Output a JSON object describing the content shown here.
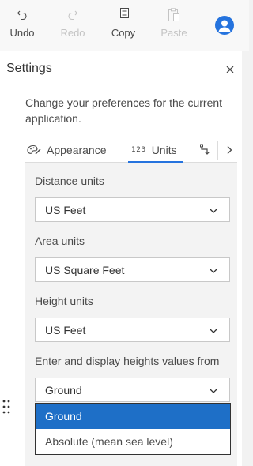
{
  "toolbar": {
    "undo": {
      "label": "Undo",
      "icon": "undo-icon",
      "enabled": true
    },
    "redo": {
      "label": "Redo",
      "icon": "redo-icon",
      "enabled": false
    },
    "copy": {
      "label": "Copy",
      "icon": "copy-icon",
      "enabled": true
    },
    "paste": {
      "label": "Paste",
      "icon": "paste-icon",
      "enabled": false
    },
    "user": {
      "icon": "user-avatar-icon"
    }
  },
  "panel": {
    "title": "Settings",
    "description": "Change your preferences for the current application.",
    "tabs": [
      {
        "label": "Appearance",
        "icon": "palette-icon",
        "active": false
      },
      {
        "label": "Units",
        "icon": "numbers-123-icon",
        "active": true
      },
      {
        "label": "",
        "icon": "snapping-icon",
        "active": false
      }
    ]
  },
  "units": {
    "distance": {
      "label": "Distance units",
      "value": "US Feet"
    },
    "area": {
      "label": "Area units",
      "value": "US Square Feet"
    },
    "height": {
      "label": "Height units",
      "value": "US Feet"
    },
    "height_reference": {
      "label": "Enter and display heights values from",
      "value": "Ground",
      "options": [
        "Ground",
        "Absolute (mean sea level)"
      ]
    }
  },
  "colors": {
    "accent": "#2573de",
    "selected": "#1e6fc7"
  }
}
